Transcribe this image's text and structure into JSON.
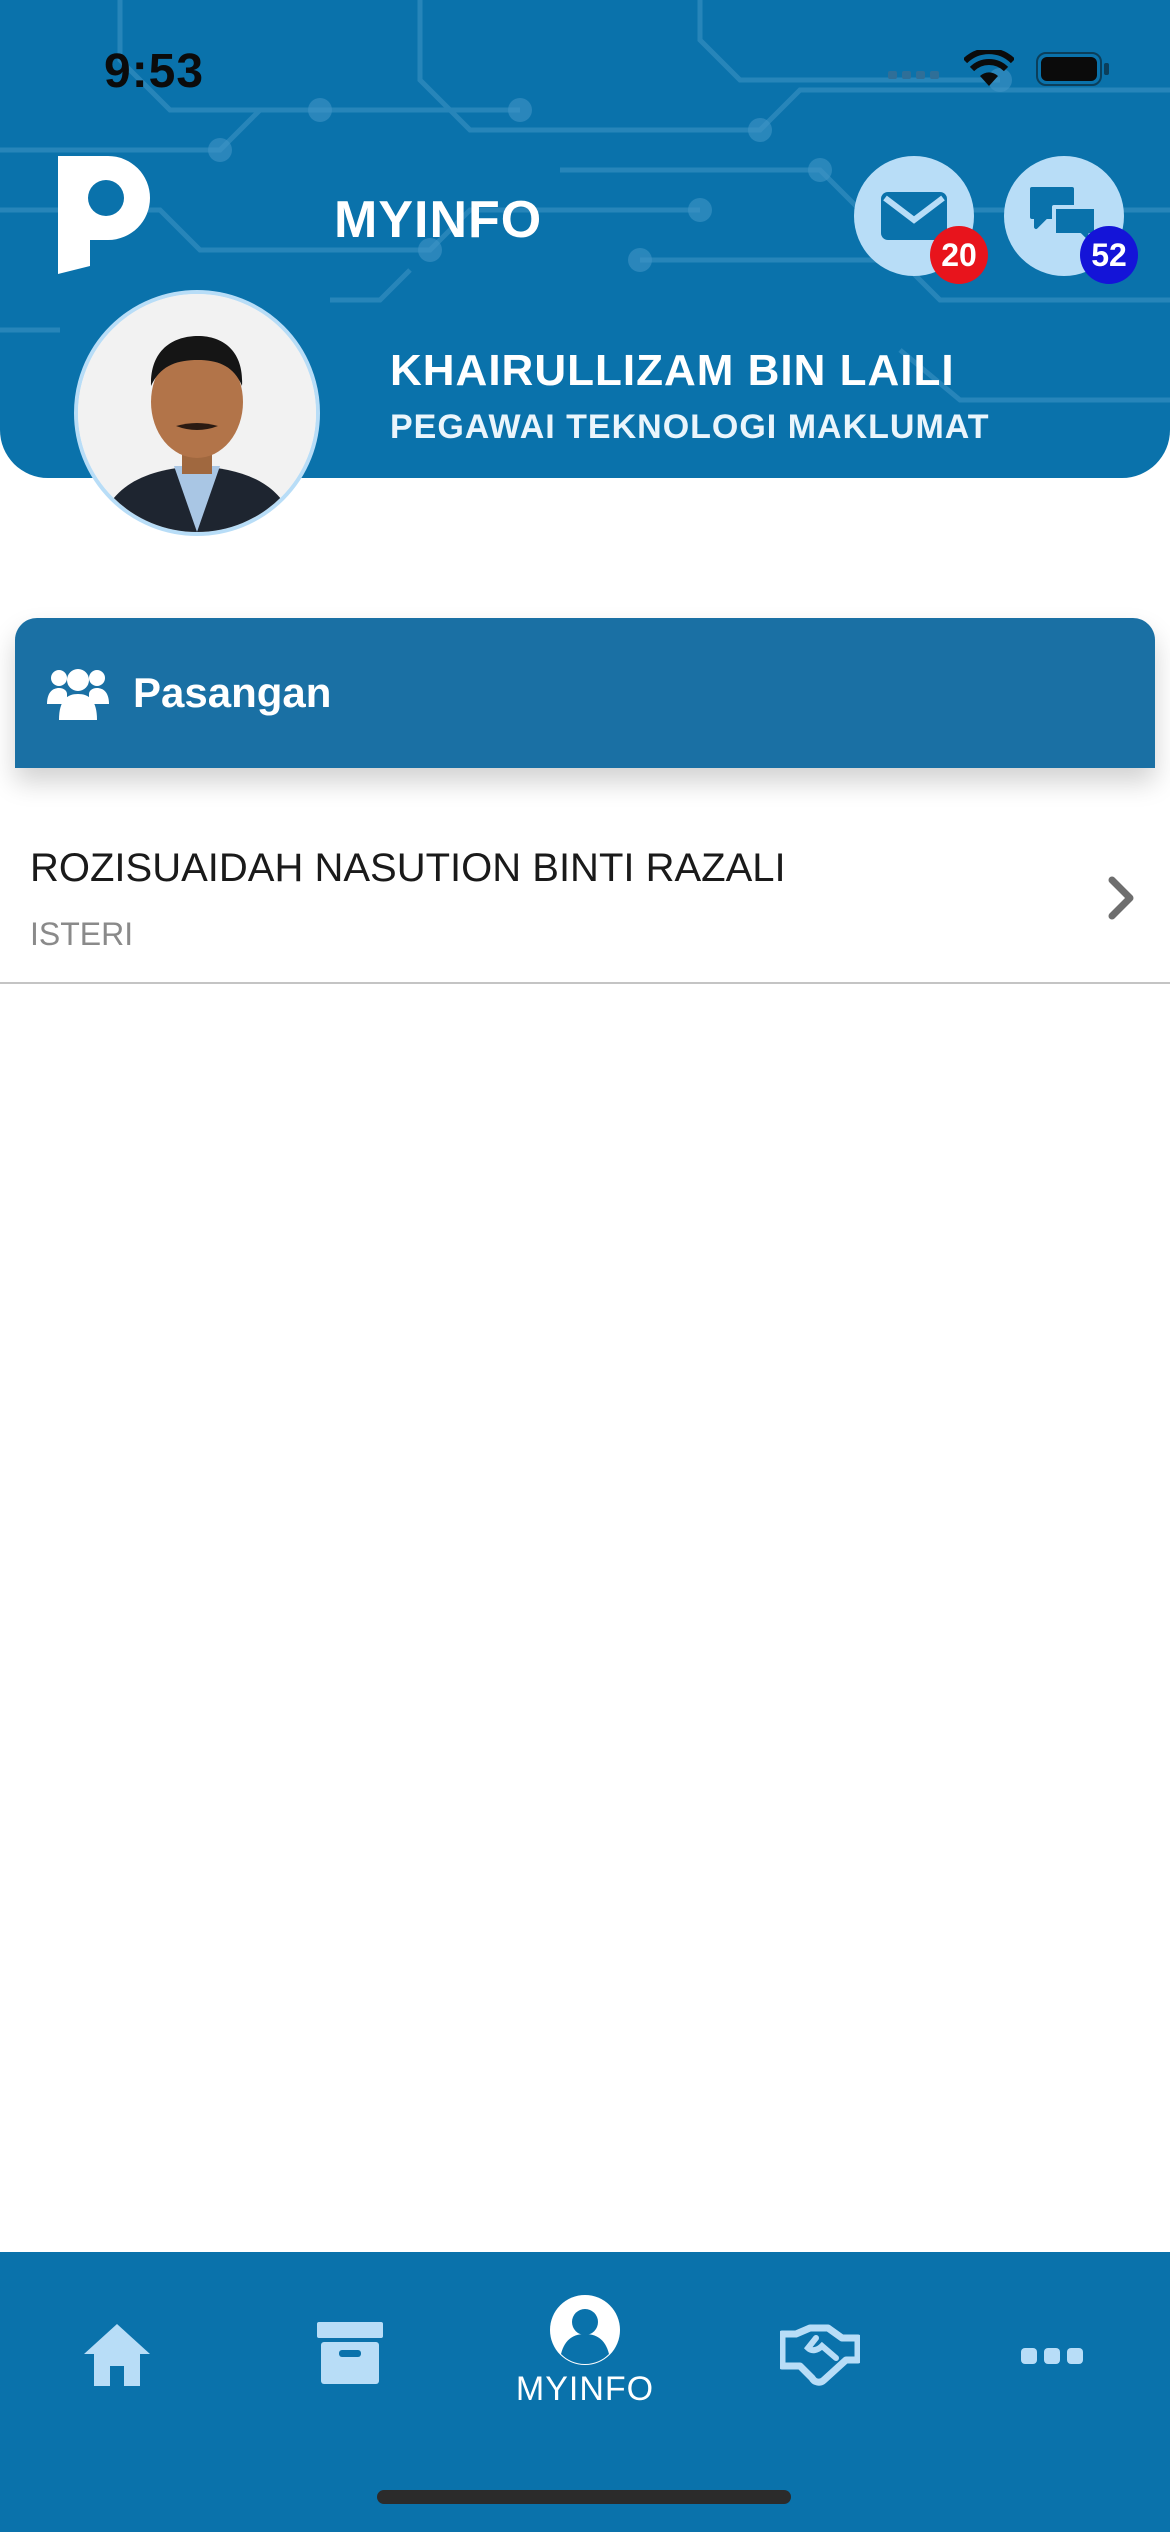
{
  "status_bar": {
    "time": "9:53"
  },
  "header": {
    "title": "MYINFO",
    "mail_badge": "20",
    "chat_badge": "52",
    "user_name": "KHAIRULLIZAM BIN LAILI",
    "user_role": "PEGAWAI TEKNOLOGI MAKLUMAT"
  },
  "section": {
    "title": "Pasangan",
    "items": [
      {
        "name": "ROZISUAIDAH NASUTION BINTI RAZALI",
        "relation": "ISTERI"
      }
    ]
  },
  "tabbar": {
    "active_label": "MYINFO",
    "icons": [
      "home-icon",
      "archive-icon",
      "user-icon",
      "handshake-icon",
      "more-icon"
    ]
  },
  "colors": {
    "primary": "#0a72ab",
    "section_header": "#1a70a4",
    "icon_light": "#b8ddf7",
    "badge_red": "#e8141c",
    "badge_blue": "#1414d8"
  }
}
